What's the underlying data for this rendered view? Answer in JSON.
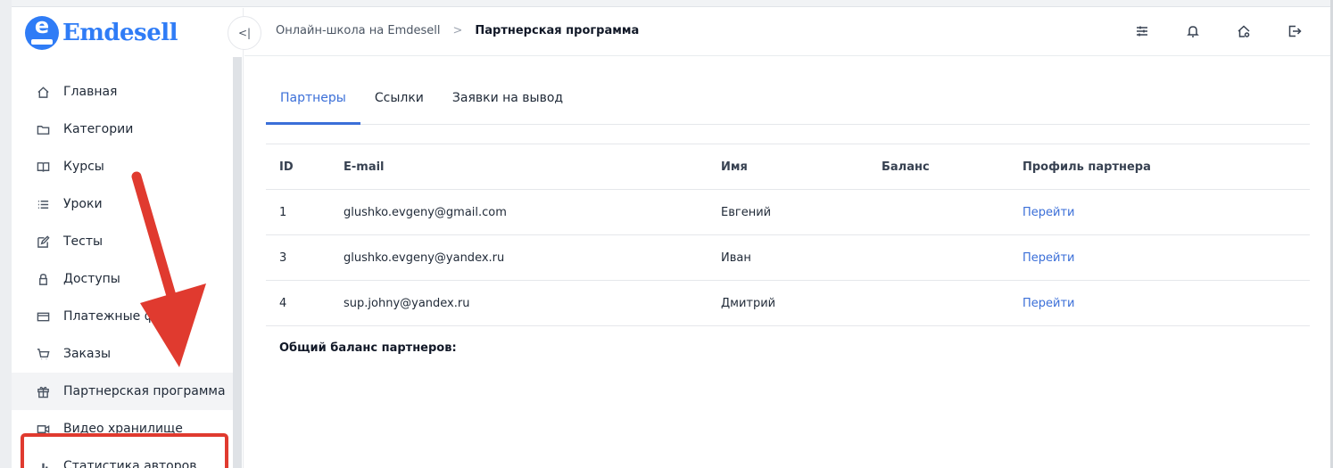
{
  "brand": {
    "name": "Emdesell",
    "logo_letter": "e",
    "color": "#2f7cf6"
  },
  "sidebar": {
    "items": [
      {
        "label": "Главная",
        "icon": "home-icon"
      },
      {
        "label": "Категории",
        "icon": "folder-icon"
      },
      {
        "label": "Курсы",
        "icon": "book-icon"
      },
      {
        "label": "Уроки",
        "icon": "list-icon"
      },
      {
        "label": "Тесты",
        "icon": "edit-icon"
      },
      {
        "label": "Доступы",
        "icon": "lock-icon"
      },
      {
        "label": "Платежные ф",
        "icon": "card-icon"
      },
      {
        "label": "Заказы",
        "icon": "cart-icon"
      },
      {
        "label": "Партнерская программа",
        "icon": "gift-icon",
        "active": true
      },
      {
        "label": "Видео хранилище",
        "icon": "video-icon"
      },
      {
        "label": "Статистика авторов",
        "icon": "chart-icon"
      }
    ]
  },
  "header": {
    "collapse_glyph": "<|",
    "breadcrumb": {
      "parent": "Онлайн-школа на Emdesell",
      "separator": ">",
      "current": "Партнерская программа"
    },
    "actions": [
      "settings-sliders-icon",
      "bell-icon",
      "home-gear-icon",
      "logout-icon"
    ]
  },
  "tabs": [
    {
      "label": "Партнеры",
      "active": true
    },
    {
      "label": "Ссылки",
      "active": false
    },
    {
      "label": "Заявки на вывод",
      "active": false
    }
  ],
  "table": {
    "headers": [
      "ID",
      "E-mail",
      "Имя",
      "Баланс",
      "Профиль партнера"
    ],
    "rows": [
      {
        "id": "1",
        "email": "glushko.evgeny@gmail.com",
        "name": "Евгений",
        "balance": "",
        "profile": "Перейти"
      },
      {
        "id": "3",
        "email": "glushko.evgeny@yandex.ru",
        "name": "Иван",
        "balance": "",
        "profile": "Перейти"
      },
      {
        "id": "4",
        "email": "sup.johny@yandex.ru",
        "name": "Дмитрий",
        "balance": "",
        "profile": "Перейти"
      }
    ]
  },
  "total_label": "Общий баланс партнеров:",
  "colors": {
    "accent": "#3b6fd8",
    "annotation": "#e03a2f"
  }
}
